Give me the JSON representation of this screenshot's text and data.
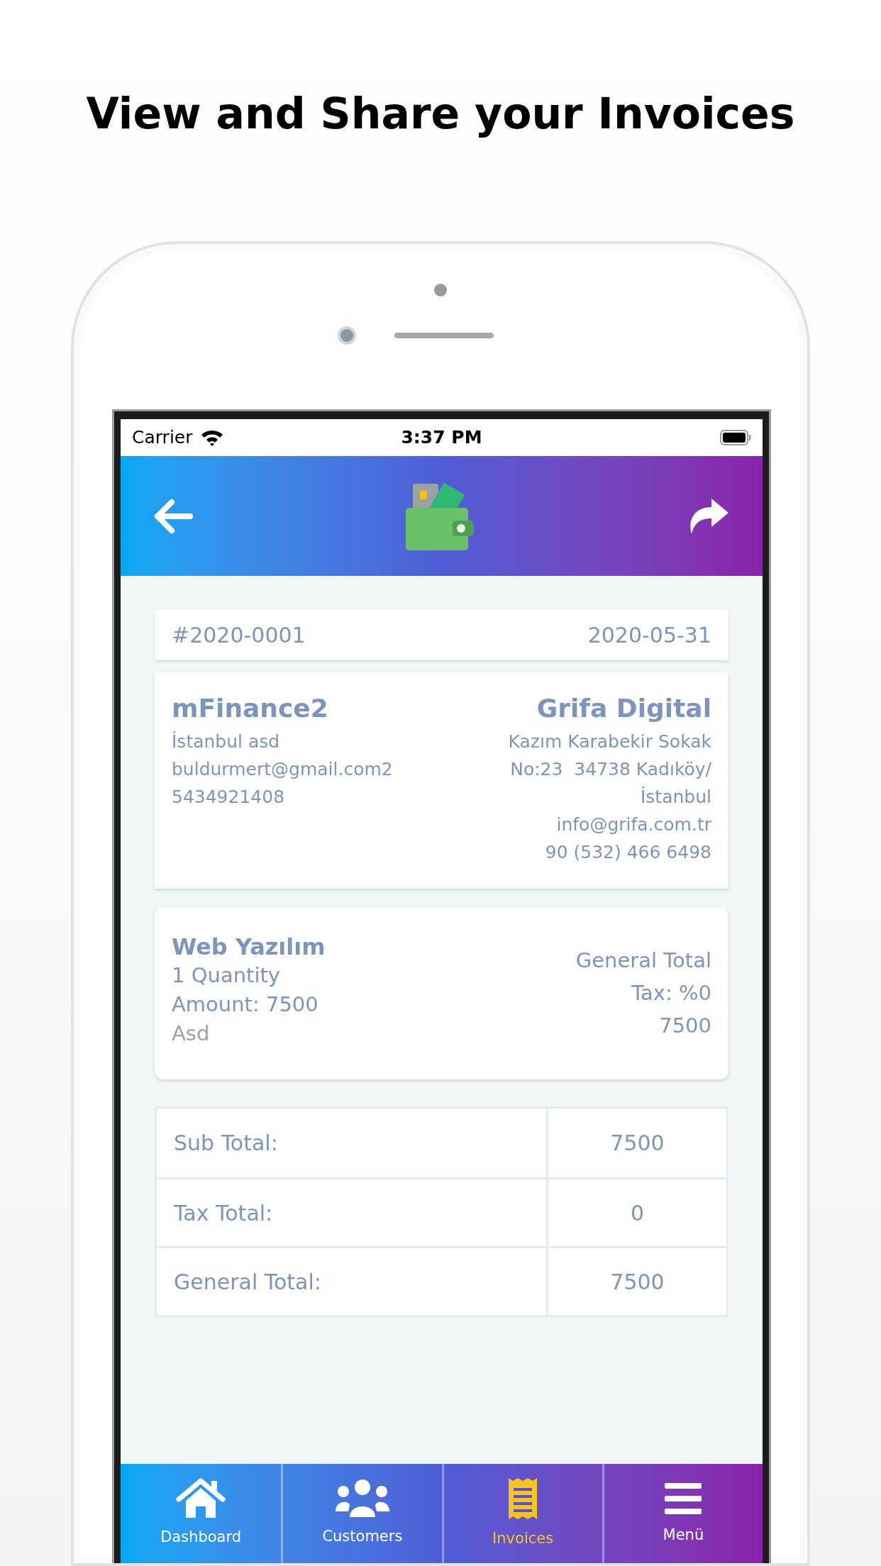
{
  "headline": "View and Share your Invoices",
  "status_bar": {
    "carrier": "Carrier",
    "time": "3:37 PM"
  },
  "invoice": {
    "number": "#2020-0001",
    "date": "2020-05-31"
  },
  "customer": {
    "name": "mFinance2",
    "lines": [
      "İstanbul asd",
      "buldurmert@gmail.com2",
      "5434921408"
    ]
  },
  "company": {
    "name": "Grifa Digital",
    "lines": [
      "Kazım Karabekir Sokak",
      "No:23  34738 Kadıköy/",
      "İstanbul",
      "info@grifa.com.tr",
      "90 (532) 466 6498"
    ]
  },
  "items": [
    {
      "name": "Web Yazılım",
      "quantity": "1 Quantity",
      "amount": "Amount: 7500",
      "note": "Asd",
      "total_label": "General Total",
      "tax": "Tax: %0",
      "total": "7500"
    }
  ],
  "totals": [
    {
      "label": "Sub Total:",
      "value": "7500"
    },
    {
      "label": "Tax Total:",
      "value": "0"
    },
    {
      "label": "General Total:",
      "value": "7500"
    }
  ],
  "tabs": [
    {
      "label": "Dashboard",
      "kind": "home",
      "selected": false
    },
    {
      "label": "Customers",
      "kind": "people",
      "selected": false
    },
    {
      "label": "Invoices",
      "kind": "receipt",
      "selected": true
    },
    {
      "label": "Menü",
      "kind": "menu",
      "selected": false
    }
  ]
}
